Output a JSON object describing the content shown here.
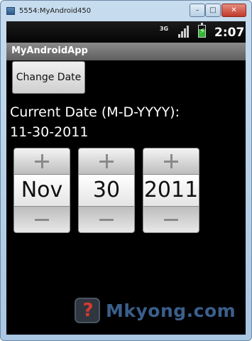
{
  "window": {
    "title": "5554:MyAndroid450",
    "close_glyph": "✕",
    "minimize_glyph": "–",
    "maximize_glyph": "□"
  },
  "status_bar": {
    "network": "3G",
    "time": "2:07",
    "battery_icon": "battery-charging-icon",
    "signal_icon": "signal-bars-icon"
  },
  "app_bar": {
    "title": "MyAndroidApp"
  },
  "change_button": {
    "label": "Change Date"
  },
  "current_date": {
    "label": "Current Date (M-D-YYYY):",
    "value": "11-30-2011"
  },
  "date_picker": {
    "month": "Nov",
    "day": "30",
    "year": "2011"
  },
  "watermark": {
    "text": "Mkyong.com",
    "logo_glyph": "?"
  },
  "colors": {
    "screen_bg": "#000000",
    "app_bar": "#6e6e6e",
    "picker_face": "#ffffff",
    "watermark": "#3b5f8c"
  }
}
